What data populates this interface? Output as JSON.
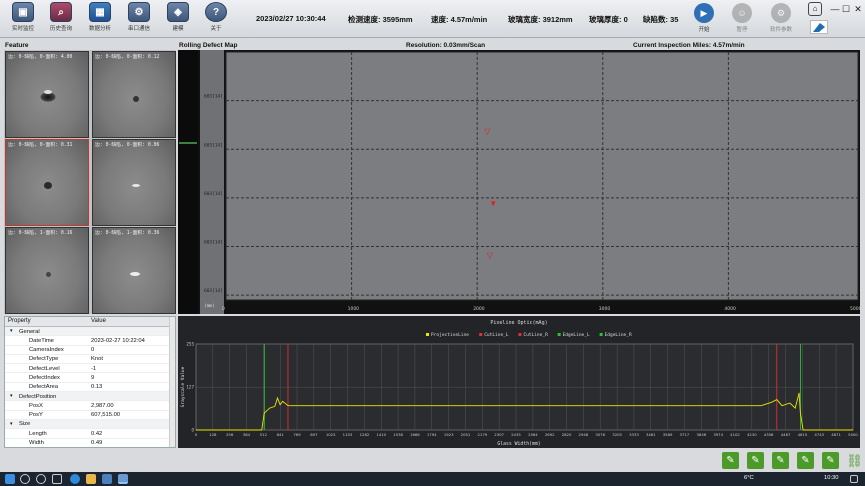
{
  "toolbar": {
    "buttons": [
      {
        "label": "实时监控",
        "icon": "monitor-icon"
      },
      {
        "label": "历史查询",
        "icon": "history-search-icon"
      },
      {
        "label": "数据分析",
        "icon": "analysis-icon"
      },
      {
        "label": "串口通信",
        "icon": "serial-port-icon"
      },
      {
        "label": "建模",
        "icon": "modeling-icon"
      },
      {
        "label": "关于",
        "icon": "help-icon"
      }
    ],
    "datetime": "2023/02/27 10:30:44",
    "detect_length": "检测速度: 3595mm",
    "speed": "速度: 4.57m/min",
    "glass_width": "玻璃宽度: 3912mm",
    "glass_thickness": "玻璃厚度: 0",
    "defect_count": "缺陷数: 35",
    "start_label": "开始",
    "stop_label": "暂停",
    "params_label": "软件参数"
  },
  "left": {
    "feature_title": "Feature",
    "thumbnails": [
      {
        "caption": "边: 0-缺陷, 0-面积: 4.00"
      },
      {
        "caption": "边: 0-缺陷, 0-面积: 0.12"
      },
      {
        "caption": "边: 0-缺陷, 0-面积: 0.31"
      },
      {
        "caption": "边: 0-缺陷, 0-面积: 0.06"
      },
      {
        "caption": "边: 0-缺陷, 1-面积: 0.16"
      },
      {
        "caption": "边: 0-缺陷, 1-面积: 0.36"
      }
    ]
  },
  "properties": {
    "col_property": "Property",
    "col_value": "Value",
    "rows": [
      {
        "type": "cat",
        "key": "General",
        "value": ""
      },
      {
        "type": "item",
        "key": "DateTime",
        "value": "2023-02-27 10:22:04"
      },
      {
        "type": "item",
        "key": "CameraIndex",
        "value": "0"
      },
      {
        "type": "item",
        "key": "DefectType",
        "value": "Knot"
      },
      {
        "type": "item",
        "key": "DefectLevel",
        "value": "-1"
      },
      {
        "type": "item",
        "key": "DefectIndex",
        "value": "9"
      },
      {
        "type": "item",
        "key": "DefectArea",
        "value": "0.13"
      },
      {
        "type": "cat",
        "key": "DefectPosition",
        "value": ""
      },
      {
        "type": "item",
        "key": "PosX",
        "value": "2,987.00"
      },
      {
        "type": "item",
        "key": "PosY",
        "value": "607,515.00"
      },
      {
        "type": "cat",
        "key": "Size",
        "value": ""
      },
      {
        "type": "item",
        "key": "Length",
        "value": "0.42"
      },
      {
        "type": "item",
        "key": "Width",
        "value": "0.49"
      }
    ]
  },
  "map": {
    "title": "Rolling Defect Map",
    "resolution": "Resolution: 0.03mm/Scan",
    "miles": "Current Inspection Miles: 4.57m/min",
    "y_ticks": [
      "603[14]",
      "603[14]",
      "603[14]",
      "603[14]",
      "603[14]"
    ],
    "y_unit": "(mm)",
    "x_ticks": [
      "0",
      "1000",
      "2000",
      "3000",
      "4000",
      "5000"
    ],
    "defects": [
      {
        "x": 2080,
        "y": 0.33,
        "symbol": "▽"
      },
      {
        "x": 2120,
        "y": 0.62,
        "symbol": "▼"
      },
      {
        "x": 2100,
        "y": 0.83,
        "symbol": "▽"
      }
    ]
  },
  "chart_data": {
    "type": "line",
    "title": "Pixeline Optic(mAg)",
    "xlabel": "Glass Width(mm)",
    "ylabel": "Grayscale Value",
    "legend": [
      "ProjectiveLine",
      "CutLine_L",
      "CutLine_R",
      "EdgeLine_L",
      "EdgeLine_R"
    ],
    "legend_colors": [
      "#e6e600",
      "#e03030",
      "#e03030",
      "#30c030",
      "#30c030"
    ],
    "xlim": [
      0,
      5000
    ],
    "ylim": [
      0,
      255
    ],
    "y_ticks": [
      "255",
      "127",
      "0"
    ],
    "x_ticks": [
      "0",
      "128",
      "256",
      "384",
      "512",
      "641",
      "769",
      "897",
      "1025",
      "1153",
      "1282",
      "1410",
      "1538",
      "1666",
      "1794",
      "1923",
      "2051",
      "2179",
      "2307",
      "2435",
      "2564",
      "2692",
      "2820",
      "2948",
      "3076",
      "3205",
      "3333",
      "3461",
      "3589",
      "3717",
      "3846",
      "3974",
      "4102",
      "4230",
      "4358",
      "4487",
      "4615",
      "4743",
      "4871",
      "5000"
    ],
    "cutline_l": 700,
    "cutline_r": 4420,
    "edgeline_l": 520,
    "edgeline_r": 4600,
    "projective": [
      [
        0,
        0
      ],
      [
        500,
        0
      ],
      [
        520,
        50
      ],
      [
        560,
        65
      ],
      [
        600,
        70
      ],
      [
        620,
        95
      ],
      [
        640,
        75
      ],
      [
        660,
        85
      ],
      [
        700,
        72
      ],
      [
        800,
        72
      ],
      [
        2000,
        72
      ],
      [
        3000,
        72
      ],
      [
        4300,
        72
      ],
      [
        4380,
        82
      ],
      [
        4420,
        90
      ],
      [
        4460,
        72
      ],
      [
        4520,
        80
      ],
      [
        4560,
        65
      ],
      [
        4590,
        110
      ],
      [
        4600,
        50
      ],
      [
        4620,
        0
      ],
      [
        5000,
        0
      ]
    ]
  },
  "taskbar": {
    "weather": "6°C",
    "time": "10:30"
  },
  "colors": {
    "map_bg": "#7b7d80",
    "chart_bg": "#222428",
    "accent_green": "#4c9a2a"
  }
}
